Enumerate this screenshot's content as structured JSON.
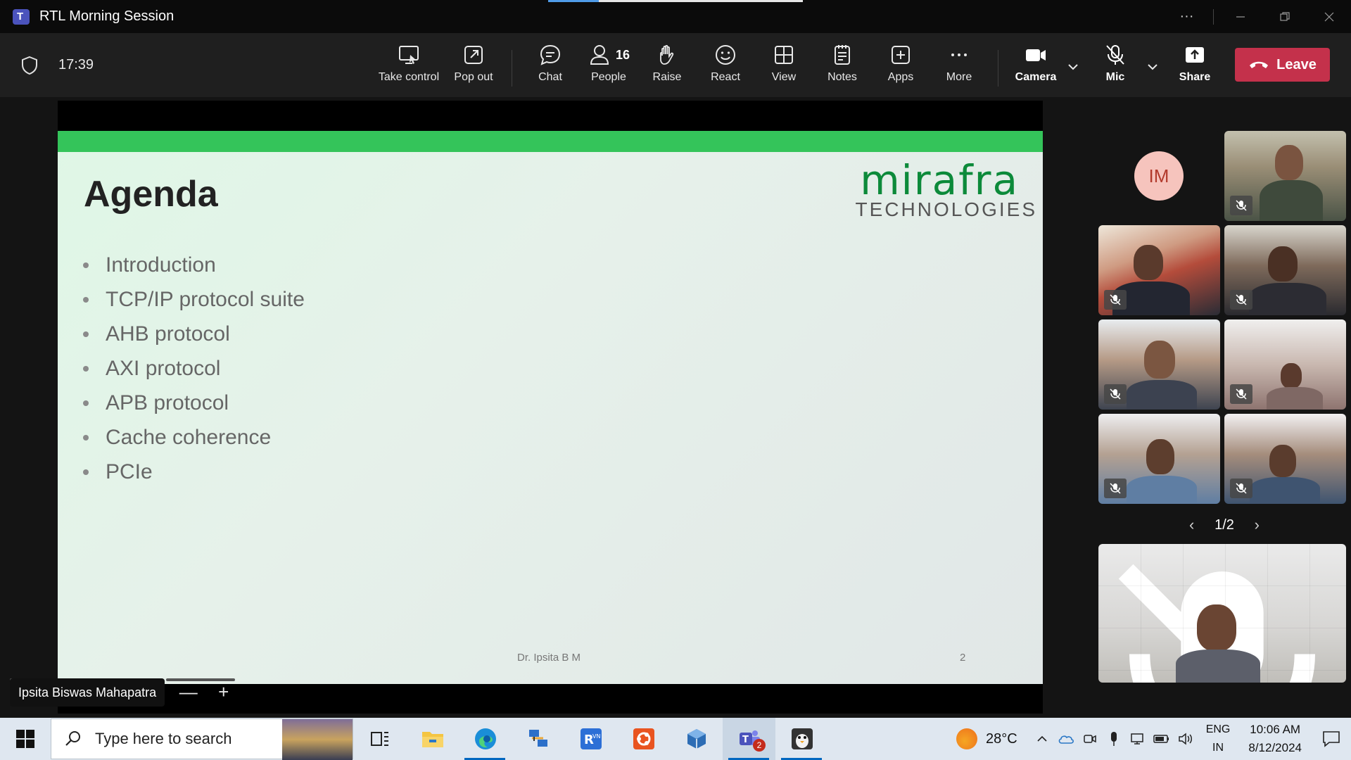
{
  "window": {
    "title": "RTL Morning Session"
  },
  "toolbar": {
    "timer": "17:39",
    "take_control": "Take control",
    "pop_out": "Pop out",
    "chat": "Chat",
    "people": "People",
    "people_count": "16",
    "raise": "Raise",
    "react": "React",
    "view": "View",
    "notes": "Notes",
    "apps": "Apps",
    "more": "More",
    "camera": "Camera",
    "mic": "Mic",
    "share": "Share",
    "leave": "Leave"
  },
  "slide": {
    "brand": "mirafra",
    "brand_sub": "TECHNOLOGIES",
    "heading": "Agenda",
    "items": [
      "Introduction",
      "TCP/IP protocol suite",
      "AHB protocol",
      "AXI protocol",
      "APB protocol",
      "Cache coherence",
      "PCIe"
    ],
    "footer_name": "Dr. Ipsita B M",
    "page_number": "2"
  },
  "presenter": {
    "name": "Ipsita Biswas Mahapatra",
    "zoom_out": "—",
    "zoom_in": "+"
  },
  "participants": {
    "avatar_initials": "IM",
    "pager": "1/2"
  },
  "taskbar": {
    "search_placeholder": "Type here to search",
    "teams_badge": "2",
    "weather_temp": "28°C",
    "lang_top": "ENG",
    "lang_bottom": "IN",
    "time": "10:06 AM",
    "date": "8/12/2024"
  },
  "colors": {
    "leave_red": "#c4314b",
    "slide_green_bar": "#34c45a",
    "brand_green": "#0c8a3a",
    "taskbar_bg": "#dfe7f0"
  }
}
